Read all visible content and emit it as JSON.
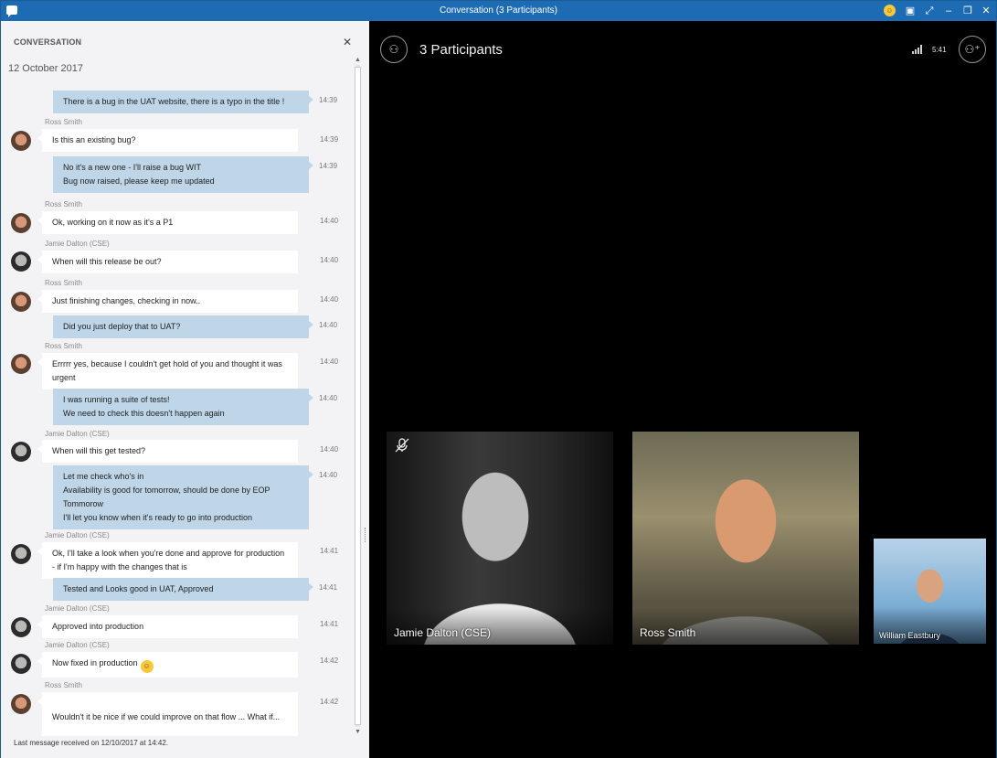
{
  "window": {
    "title": "Conversation (3 Participants)",
    "controls": [
      "emoji",
      "layout",
      "fullscreen",
      "minimize",
      "restore",
      "close"
    ]
  },
  "conversation": {
    "header": "CONVERSATION",
    "close_glyph": "✕",
    "date": "12 October 2017",
    "footer": "Last message received on 12/10/2017 at 14:42.",
    "messages": [
      {
        "dir": "out",
        "lines": [
          "There is a bug in the UAT website, there is a typo in the title !"
        ],
        "time": "14:39"
      },
      {
        "dir": "in",
        "sender": "Ross Smith",
        "avatar": "ross",
        "lines": [
          "Is this an existing bug?"
        ],
        "time": "14:39"
      },
      {
        "dir": "out",
        "lines": [
          "No it's a new one - I'll raise a bug WIT",
          "Bug now raised, please keep me updated"
        ],
        "time": "14:39"
      },
      {
        "dir": "in",
        "sender": "Ross Smith",
        "avatar": "ross",
        "lines": [
          "Ok, working on it now as it's a P1"
        ],
        "time": "14:40"
      },
      {
        "dir": "in",
        "sender": "Jamie Dalton (CSE)",
        "avatar": "jamie",
        "lines": [
          "When will this release be out?"
        ],
        "time": "14:40"
      },
      {
        "dir": "in",
        "sender": "Ross Smith",
        "avatar": "ross",
        "lines": [
          "Just finishing changes, checking in now.."
        ],
        "time": "14:40"
      },
      {
        "dir": "out",
        "lines": [
          "Did you just deploy that to UAT?"
        ],
        "time": "14:40"
      },
      {
        "dir": "in",
        "sender": "Ross Smith",
        "avatar": "ross",
        "lines": [
          "Errrrr yes, because I couldn't get hold of you and thought it was urgent"
        ],
        "time": "14:40"
      },
      {
        "dir": "out",
        "lines": [
          "I was running a suite of tests!",
          "We need to check this doesn't happen again"
        ],
        "time": "14:40"
      },
      {
        "dir": "in",
        "sender": "Jamie Dalton (CSE)",
        "avatar": "jamie",
        "lines": [
          "When will this get tested?"
        ],
        "time": "14:40"
      },
      {
        "dir": "out",
        "lines": [
          "Let me check who's in",
          "Availability is good for tomorrow, should be done by EOP Tommorow",
          "I'll let you know when it's ready to go into production"
        ],
        "time": "14:40"
      },
      {
        "dir": "in",
        "sender": "Jamie Dalton (CSE)",
        "avatar": "jamie",
        "lines": [
          "Ok, I'll take a look when you're done and approve for production - if I'm happy with the changes that is"
        ],
        "time": "14:41"
      },
      {
        "dir": "out",
        "lines": [
          "Tested and Looks good in UAT, Approved"
        ],
        "time": "14:41"
      },
      {
        "dir": "in",
        "sender": "Jamie Dalton (CSE)",
        "avatar": "jamie",
        "lines": [
          "Approved into production"
        ],
        "time": "14:41"
      },
      {
        "dir": "in",
        "sender": "Jamie Dalton (CSE)",
        "avatar": "jamie",
        "lines": [
          "Now fixed in production"
        ],
        "emoji": "smiley",
        "time": "14:42"
      },
      {
        "dir": "in",
        "sender": "Ross Smith",
        "avatar": "ross",
        "lines": [
          "Wouldn't it be nice if we could improve on that flow ... What if..."
        ],
        "time": "14:42"
      }
    ]
  },
  "call": {
    "participants_label": "3 Participants",
    "call_time": "5:41",
    "participants": [
      {
        "name": "Jamie Dalton (CSE)",
        "muted": true
      },
      {
        "name": "Ross Smith",
        "muted": false
      },
      {
        "name": "William Eastbury",
        "muted": false
      }
    ]
  },
  "colors": {
    "titlebar": "#1d6cb3",
    "outgoing_bubble": "#bed6e8",
    "incoming_bubble": "#ffffff",
    "call_background": "#000000"
  },
  "icons": [
    "app-icon",
    "emoji-icon",
    "layout-icon",
    "fullscreen-icon",
    "minimize-icon",
    "restore-icon",
    "close-icon",
    "participants-icon",
    "signal-icon",
    "add-participant-icon",
    "mic-muted-icon"
  ]
}
